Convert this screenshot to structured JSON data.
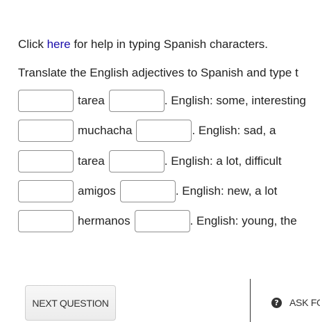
{
  "help": {
    "prefix": "Click ",
    "link": "here",
    "suffix": " for help in typing Spanish characters."
  },
  "instruction": "Translate the English adjectives to Spanish and type t",
  "rows": [
    {
      "first_value": "",
      "word": "tarea",
      "second_value": "",
      "hint": ". English: some, interesting"
    },
    {
      "first_value": "",
      "word": "muchacha",
      "second_value": "",
      "hint": ". English: sad, a"
    },
    {
      "first_value": "",
      "word": "tarea",
      "second_value": "",
      "hint": ". English: a lot, difficult"
    },
    {
      "first_value": "",
      "word": "amigos",
      "second_value": "",
      "hint": ". English: new, a lot"
    },
    {
      "first_value": "",
      "word": "hermanos",
      "second_value": "",
      "hint": ". English: young, the"
    }
  ],
  "footer": {
    "next_label": "NEXT QUESTION",
    "help_icon": "question-circle-icon",
    "ask_label": "ASK FOR"
  }
}
